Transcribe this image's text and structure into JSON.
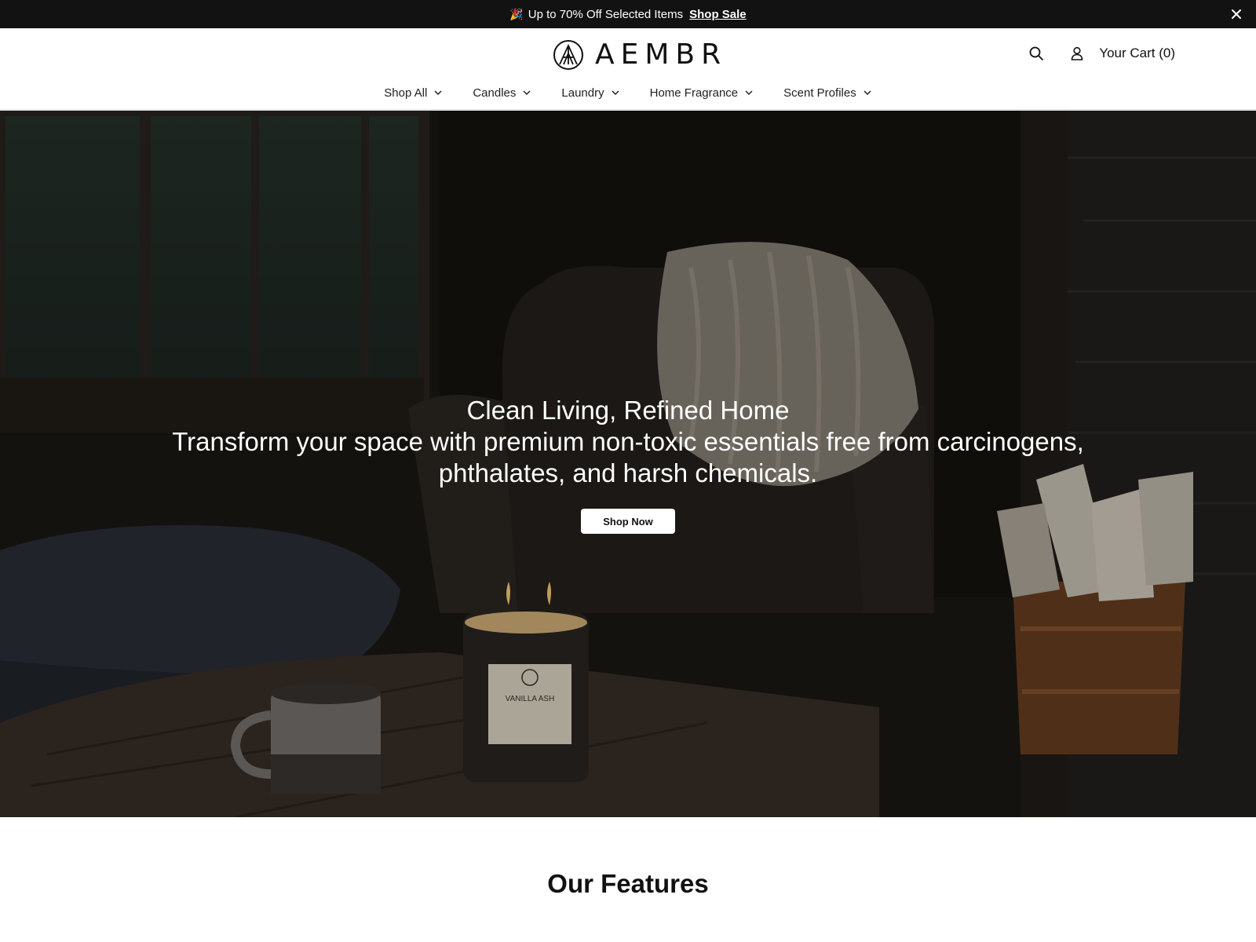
{
  "announcement": {
    "text": "Up to 70% Off Selected Items",
    "link_label": "Shop Sale",
    "emoji": "🎉"
  },
  "header": {
    "logo_text": "AEMBR",
    "cart_label": "Your Cart (0)"
  },
  "nav": {
    "items": [
      {
        "label": "Shop All"
      },
      {
        "label": "Candles"
      },
      {
        "label": "Laundry"
      },
      {
        "label": "Home Fragrance"
      },
      {
        "label": "Scent Profiles"
      }
    ]
  },
  "hero": {
    "title": "Clean Living, Refined Home",
    "subtitle": "Transform your space with premium non-toxic essentials free from carcinogens, phthalates, and harsh chemicals.",
    "cta_label": "Shop Now",
    "candle_label": "VANILLA ASH"
  },
  "features": {
    "title": "Our Features"
  },
  "colors": {
    "announcement_bg": "#121212",
    "text": "#111111",
    "hero_bg": "#1c1a17",
    "button_bg": "#ffffff"
  },
  "icons": [
    "party-icon",
    "close-icon",
    "logo-mark-icon",
    "search-icon",
    "account-icon",
    "chevron-down-icon"
  ]
}
